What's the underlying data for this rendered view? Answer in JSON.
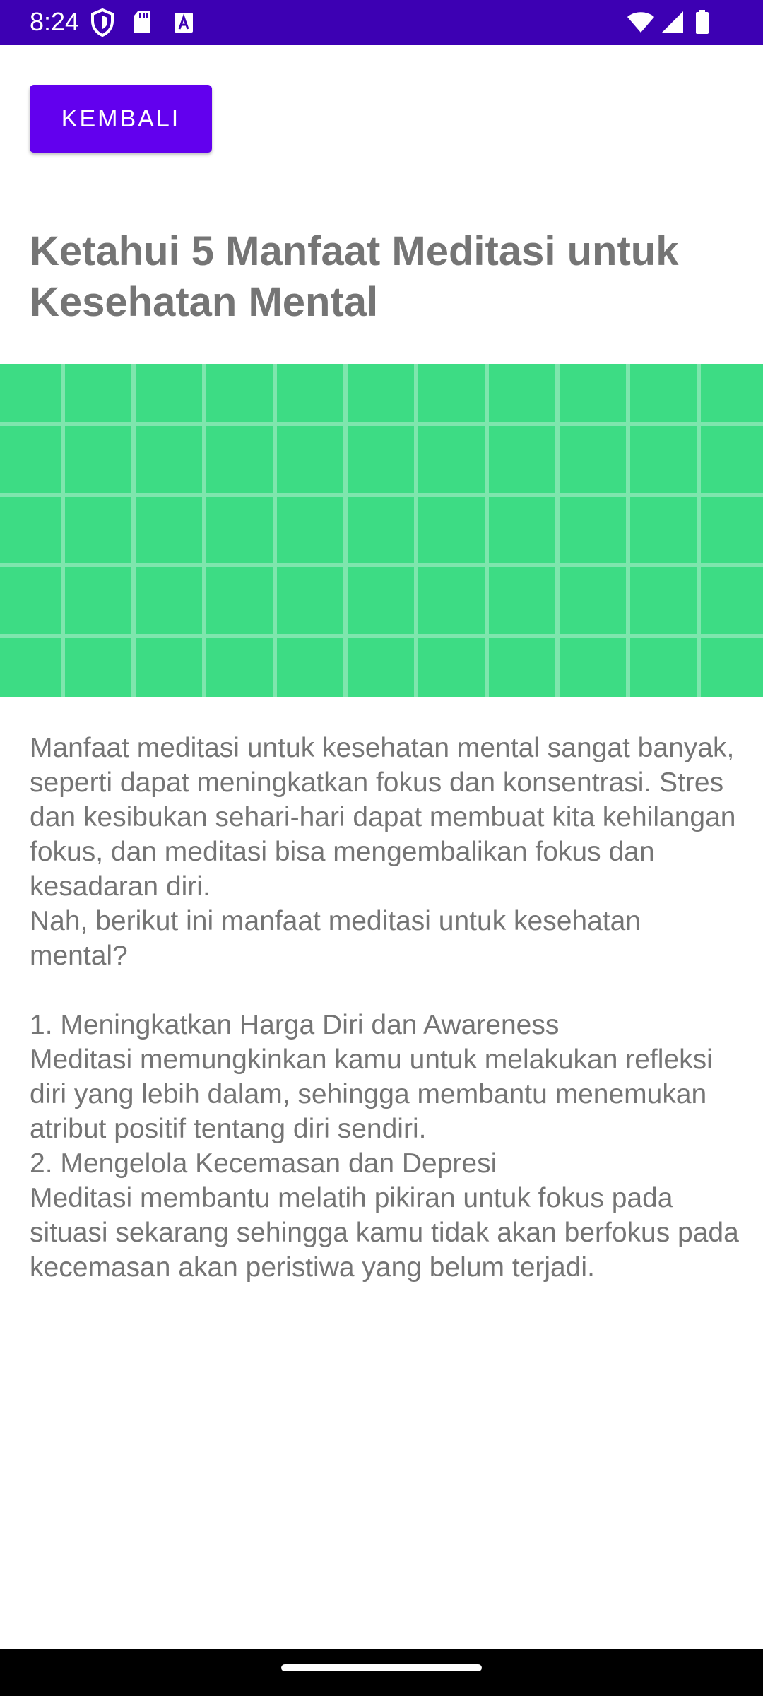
{
  "status_bar": {
    "time": "8:24",
    "background": "#3d00b3",
    "left_icons": [
      "shield-icon",
      "sd-card-icon",
      "font-a-icon"
    ],
    "right_icons": [
      "wifi-icon",
      "signal-icon",
      "battery-icon"
    ]
  },
  "toolbar": {
    "back_label": "KEMBALI",
    "accent": "#6200ee"
  },
  "article": {
    "title": "Ketahui 5 Manfaat Meditasi untuk Kesehatan Mental",
    "banner_color": "#3ddc84",
    "intro": [
      "Manfaat meditasi untuk kesehatan mental sangat banyak, seperti dapat meningkatkan fokus dan konsentrasi. Stres dan kesibukan sehari-hari dapat membuat kita kehilangan fokus, dan meditasi bisa mengembalikan fokus dan kesadaran diri.",
      "Nah, berikut ini manfaat meditasi untuk kesehatan mental?"
    ],
    "points": [
      {
        "heading": "1. Meningkatkan Harga Diri dan Awareness",
        "text": "Meditasi memungkinkan kamu untuk melakukan refleksi diri yang lebih dalam, sehingga membantu menemukan atribut positif tentang diri sendiri."
      },
      {
        "heading": "2. Mengelola Kecemasan dan Depresi",
        "text": "Meditasi membantu melatih pikiran untuk fokus pada situasi sekarang sehingga kamu tidak akan berfokus pada kecemasan akan peristiwa yang belum terjadi."
      }
    ]
  }
}
